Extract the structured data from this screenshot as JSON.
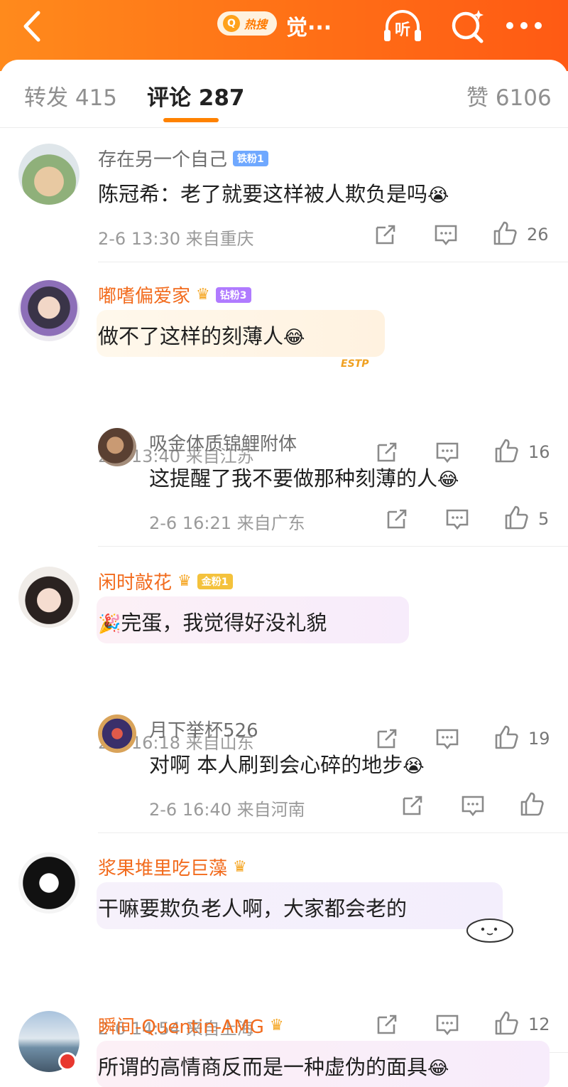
{
  "header": {
    "hot_icon": "search-icon",
    "hot_label": "热搜",
    "hot_keyword": "觉···",
    "listen_label": "听"
  },
  "tabs": {
    "repost": "转发 415",
    "comment": "评论 287",
    "like": "赞 6106"
  },
  "comments": [
    {
      "user": "存在另一个自己",
      "badge": "铁粉1",
      "text": "陈冠希：老了就要这样被人欺负是吗",
      "emoji": "😭",
      "time": "2-6 13:30 来自重庆",
      "likes": "26"
    },
    {
      "user": "嘟嗜偏爱家",
      "badge": "钻粉3",
      "text": "做不了这样的刻薄人",
      "emoji": "😂",
      "sticker": "ESTP",
      "time": "2-6 13:40 来自江苏",
      "likes": "16"
    },
    {
      "user": "吸金体质锦鲤附体",
      "text": "这提醒了我不要做那种刻薄的人",
      "emoji": "😂",
      "time": "2-6 16:21 来自广东",
      "likes": "5"
    },
    {
      "user": "闲时敲花",
      "badge": "金粉1",
      "text": "完蛋，我觉得好没礼貌",
      "emoji": "🎉",
      "time": "2-6 16:18 来自山东",
      "likes": "19"
    },
    {
      "user": "月下举杯526",
      "text": "对啊 本人刷到会心碎的地步",
      "emoji": "😭",
      "time": "2-6 16:40 来自河南",
      "likes": ""
    },
    {
      "user": "浆果堆里吃巨藻",
      "text": "干嘛要欺负老人啊，大家都会老的",
      "time": "2-6 14:54 来自上海",
      "likes": "12"
    },
    {
      "user": "瞬间-Quentin-AMG",
      "text": "所谓的高情商反而是一种虚伪的面具",
      "emoji": "😂"
    }
  ],
  "colors": {
    "accent": "#ff8200",
    "username_vip": "#f26b1d",
    "header": "#ff6f16"
  }
}
